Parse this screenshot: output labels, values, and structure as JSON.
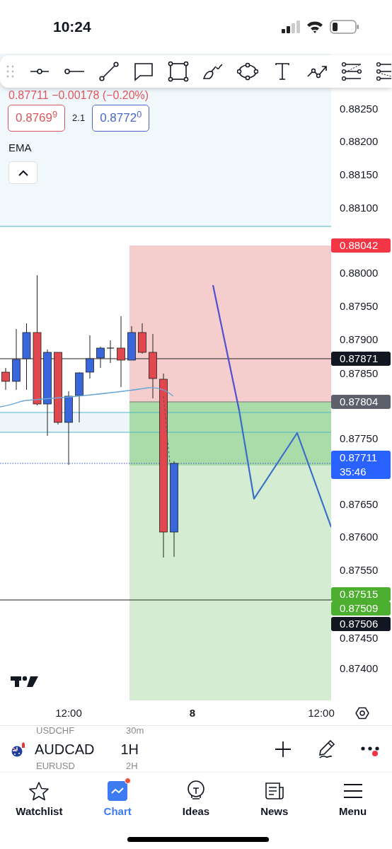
{
  "status_bar": {
    "time": "10:24"
  },
  "drawing_toolbar": {
    "tools": [
      {
        "kind": "horizontal-line"
      },
      {
        "kind": "ray"
      },
      {
        "kind": "trend-line"
      },
      {
        "kind": "callout"
      },
      {
        "kind": "rectangle"
      },
      {
        "kind": "brush"
      },
      {
        "kind": "ellipse"
      },
      {
        "kind": "text"
      },
      {
        "kind": "path"
      },
      {
        "kind": "fib-retracement"
      },
      {
        "kind": "fib-extension"
      }
    ]
  },
  "chart": {
    "quote_line": "0.87711 −0.00178 (−0.20%)",
    "bid": "0.8769$^{9}$",
    "spread": "2.1",
    "ask": "0.8772$^{0}$",
    "indicator": "EMA",
    "price_axis": [
      "0.88250",
      "0.88200",
      "0.88150",
      "0.88100",
      "0.88000",
      "0.87950",
      "0.87900",
      "0.87850",
      "0.87750",
      "0.87650",
      "0.87600",
      "0.87550",
      "0.87450",
      "0.87400"
    ],
    "price_markers": [
      {
        "label": "0.88042",
        "color": "#f23645"
      },
      {
        "label": "0.87871",
        "color": "#131722"
      },
      {
        "label": "0.87804",
        "color": "#5d606b"
      },
      {
        "label": "0.87711",
        "countdown": "35:46",
        "color": "#2962ff"
      },
      {
        "label": "0.87515",
        "color": "#4caf30"
      },
      {
        "label": "0.87509",
        "color": "#4caf30"
      },
      {
        "label": "0.87506",
        "color": "#131722"
      }
    ],
    "time_axis": [
      {
        "label": "12:00",
        "kind": "time"
      },
      {
        "label": "8",
        "kind": "day"
      },
      {
        "label": "12:00",
        "kind": "time"
      }
    ]
  },
  "symbol_bar": {
    "previous": {
      "symbol": "USDCHF",
      "interval": "30m"
    },
    "symbol": "AUDCAD",
    "interval": "1H",
    "next": {
      "symbol": "EURUSD",
      "interval": "2H"
    },
    "actions": [
      {
        "kind": "add"
      },
      {
        "kind": "draw"
      },
      {
        "kind": "more",
        "badge": true
      }
    ]
  },
  "tab_bar": [
    {
      "label": "Watchlist",
      "kind": "watchlist",
      "selected": false,
      "badge": false
    },
    {
      "label": "Chart",
      "kind": "chart",
      "selected": true,
      "badge": true
    },
    {
      "label": "Ideas",
      "kind": "ideas",
      "selected": false,
      "badge": false
    },
    {
      "label": "News",
      "kind": "news",
      "selected": false,
      "badge": false
    },
    {
      "label": "Menu",
      "kind": "menu",
      "selected": false,
      "badge": false
    }
  ]
}
